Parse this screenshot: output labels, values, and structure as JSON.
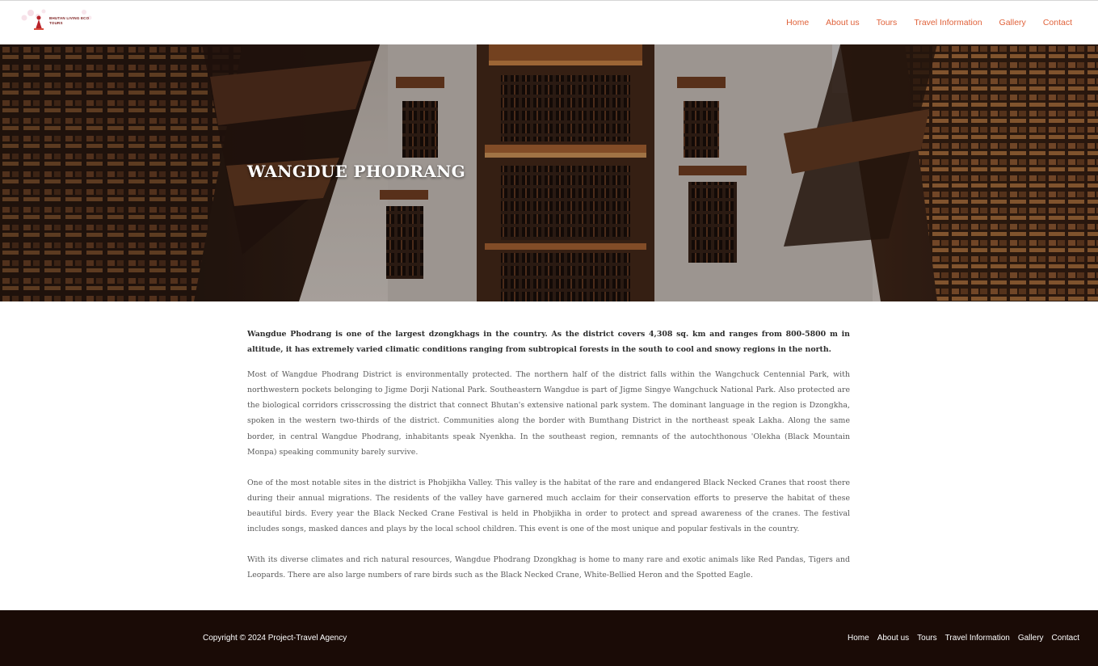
{
  "header": {
    "logo_text": "BHUTAN LIVING ECO TOURS",
    "nav": [
      "Home",
      "About us",
      "Tours",
      "Travel Information",
      "Gallery",
      "Contact"
    ]
  },
  "hero": {
    "title": "WANGDUE PHODRANG"
  },
  "content": {
    "lead": "Wangdue Phodrang is one of the largest dzongkhags in the country. As the district covers 4,308 sq. km and ranges from 800-5800 m in altitude, it has extremely varied climatic conditions ranging from subtropical forests in the south to cool and snowy regions in the north.",
    "paragraphs": [
      "Most of Wangdue Phodrang District is environmentally protected. The northern half of the district falls within the Wangchuck Centennial Park, with northwestern pockets belonging to Jigme Dorji National Park. Southeastern Wangdue is part of Jigme Singye Wangchuck National Park. Also protected are the biological corridors crisscrossing the district that connect Bhutan's extensive national park system. The dominant language in the region is Dzongkha, spoken in the western two-thirds of the district. Communities along the border with Bumthang District in the northeast speak Lakha. Along the same border, in central Wangdue Phodrang, inhabitants speak Nyenkha. In the southeast region, remnants of the autochthonous 'Olekha (Black Mountain Monpa) speaking community barely survive.",
      "One of the most notable sites in the district is Phobjikha Valley. This valley is the habitat of the rare and endangered Black Necked Cranes that roost there during their annual migrations. The residents of the valley have garnered much acclaim for their conservation efforts to preserve the habitat of these beautiful birds. Every year the Black Necked Crane Festival is held in Phobjikha in order to protect and spread awareness of the cranes. The festival includes songs, masked dances and plays by the local school children. This event is one of the most unique and popular festivals in the country.",
      "With its diverse climates and rich natural resources, Wangdue Phodrang Dzongkhag is home to many rare and exotic animals like Red Pandas, Tigers and Leopards. There are also large numbers of rare birds such as the Black Necked Crane, White-Bellied Heron and the Spotted Eagle."
    ]
  },
  "footer": {
    "copyright": "Copyright © 2024 Project-Travel Agency",
    "nav": [
      "Home",
      "About us",
      "Tours",
      "Travel Information",
      "Gallery",
      "Contact"
    ]
  },
  "colors": {
    "accent": "#e0623a",
    "footer_bg": "#1a0b06"
  }
}
